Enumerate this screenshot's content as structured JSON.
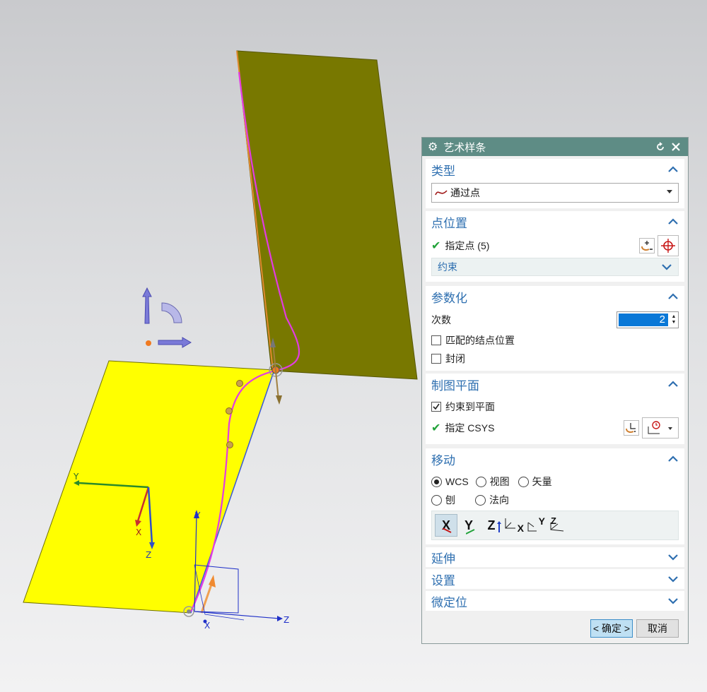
{
  "viewport": {
    "axis_labels": {
      "wcs_y": "Y",
      "wcs_x": "X",
      "wcs_z": "Z",
      "csys_y": "Y",
      "csys_x": "X",
      "csys_z": "Z"
    },
    "colors": {
      "background": "#d8d9db",
      "plane_vertical": "#787800",
      "plane_horizontal": "#ffff00",
      "spline": "#e23ce2",
      "pole": "#c8a050"
    }
  },
  "dialog": {
    "title": "艺术样条",
    "sections": {
      "type": {
        "label": "类型",
        "value": "通过点"
      },
      "point_position": {
        "label": "点位置",
        "specify_point": "指定点 (5)",
        "constraint_label": "约束"
      },
      "parameterization": {
        "label": "参数化",
        "degree_label": "次数",
        "degree_value": "2",
        "match_knots_label": "匹配的结点位置",
        "match_knots_checked": false,
        "closed_label": "封闭",
        "closed_checked": false
      },
      "drawing_plane": {
        "label": "制图平面",
        "constrain_label": "约束到平面",
        "constrain_checked": true,
        "specify_csys": "指定 CSYS"
      },
      "move": {
        "label": "移动",
        "options": [
          "WCS",
          "视图",
          "矢量",
          "刨",
          "法向"
        ],
        "selected": "WCS",
        "axis_buttons": [
          "X",
          "Y",
          "Z",
          "X",
          "Y",
          "Z"
        ]
      },
      "extend": {
        "label": "延伸"
      },
      "settings": {
        "label": "设置"
      },
      "fine_positioning": {
        "label": "微定位"
      }
    },
    "ok_label": "< 确定 >",
    "cancel_label": "取消"
  }
}
